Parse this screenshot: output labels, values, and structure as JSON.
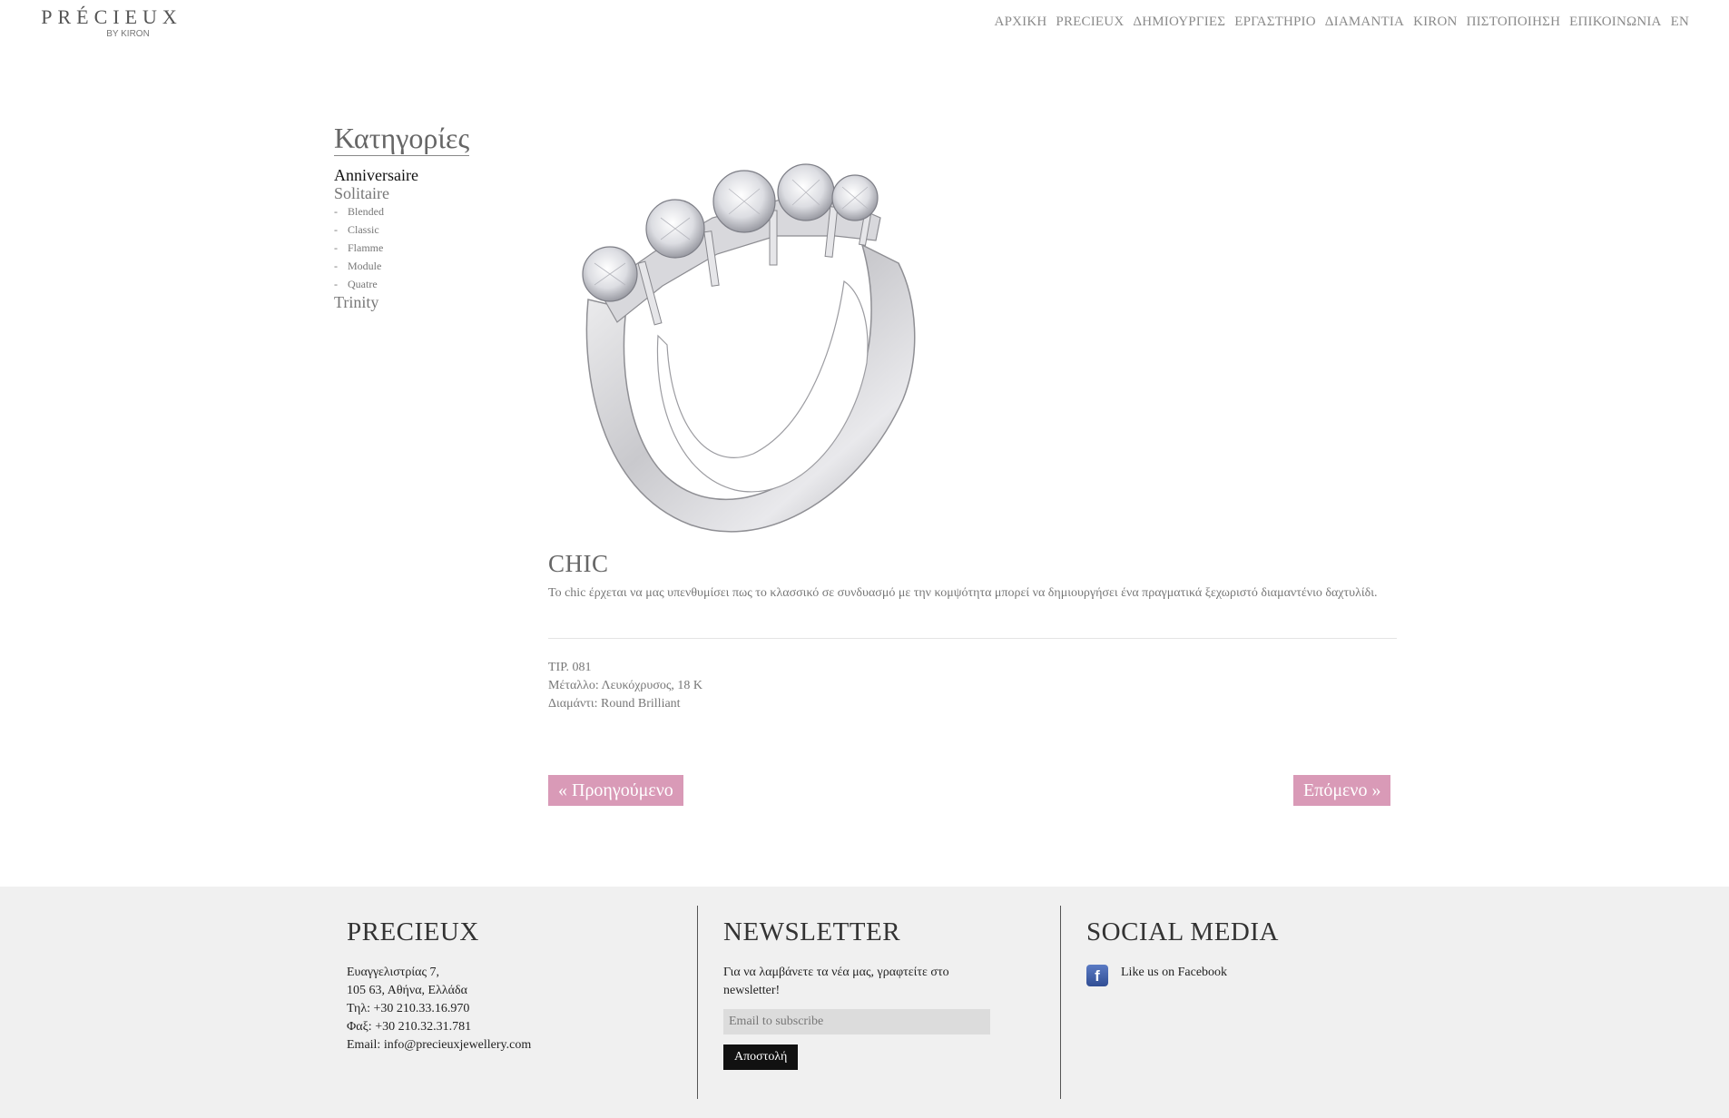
{
  "header": {
    "logo_main": "PRÉCIEUX",
    "logo_sub": "BY KIRON",
    "nav": [
      "ΑΡΧΙΚΗ",
      "PRECIEUX",
      "ΔΗΜΙΟΥΡΓΙΕΣ",
      "ΕΡΓΑΣΤΗΡΙΟ",
      "ΔΙΑΜΑΝΤΙΑ",
      "KIRON",
      "ΠΙΣΤΟΠΟΙΗΣΗ",
      "ΕΠΙΚΟΙΝΩΝΙΑ",
      "EN"
    ]
  },
  "sidebar": {
    "title": "Κατηγορίες",
    "categories": {
      "anniversaire": "Anniversaire",
      "solitaire": "Solitaire",
      "sub": [
        "Blended",
        "Classic",
        "Flamme",
        "Module",
        "Quatre"
      ],
      "trinity": "Trinity"
    }
  },
  "product": {
    "name": "CHIC",
    "description": "Το chic έρχεται να μας υπενθυμίσει πως το κλασσικό σε συνδυασμό με την κομψότητα μπορεί να δημιουργήσει ένα πραγματικά ξεχωριστό διαμαντένιο δαχτυλίδι.",
    "specs": {
      "code": "ΤΙΡ. 081",
      "metal": "Μέταλλο: Λευκόχρυσος, 18 K",
      "diamond": "Διαμάντι: Round Brilliant"
    },
    "prev_label": "« Προηγούμενο",
    "next_label": "Επόμενο »"
  },
  "footer": {
    "about": {
      "title": "PRECIEUX",
      "address1": "Ευαγγελιστρίας 7,",
      "address2": "105 63, Αθήνα, Ελλάδα",
      "phone": "Τηλ: +30 210.33.16.970",
      "fax": "Φαξ: +30 210.32.31.781",
      "email": "Email: info@precieuxjewellery.com"
    },
    "newsletter": {
      "title": "NEWSLETTER",
      "text": "Για να λαμβάνετε τα νέα μας, γραφτείτε στο newsletter!",
      "placeholder": "Email to subscribe",
      "button": "Αποστολή"
    },
    "social": {
      "title": "SOCIAL MEDIA",
      "facebook_label": "Like us on Facebook",
      "facebook_icon": "f"
    }
  }
}
